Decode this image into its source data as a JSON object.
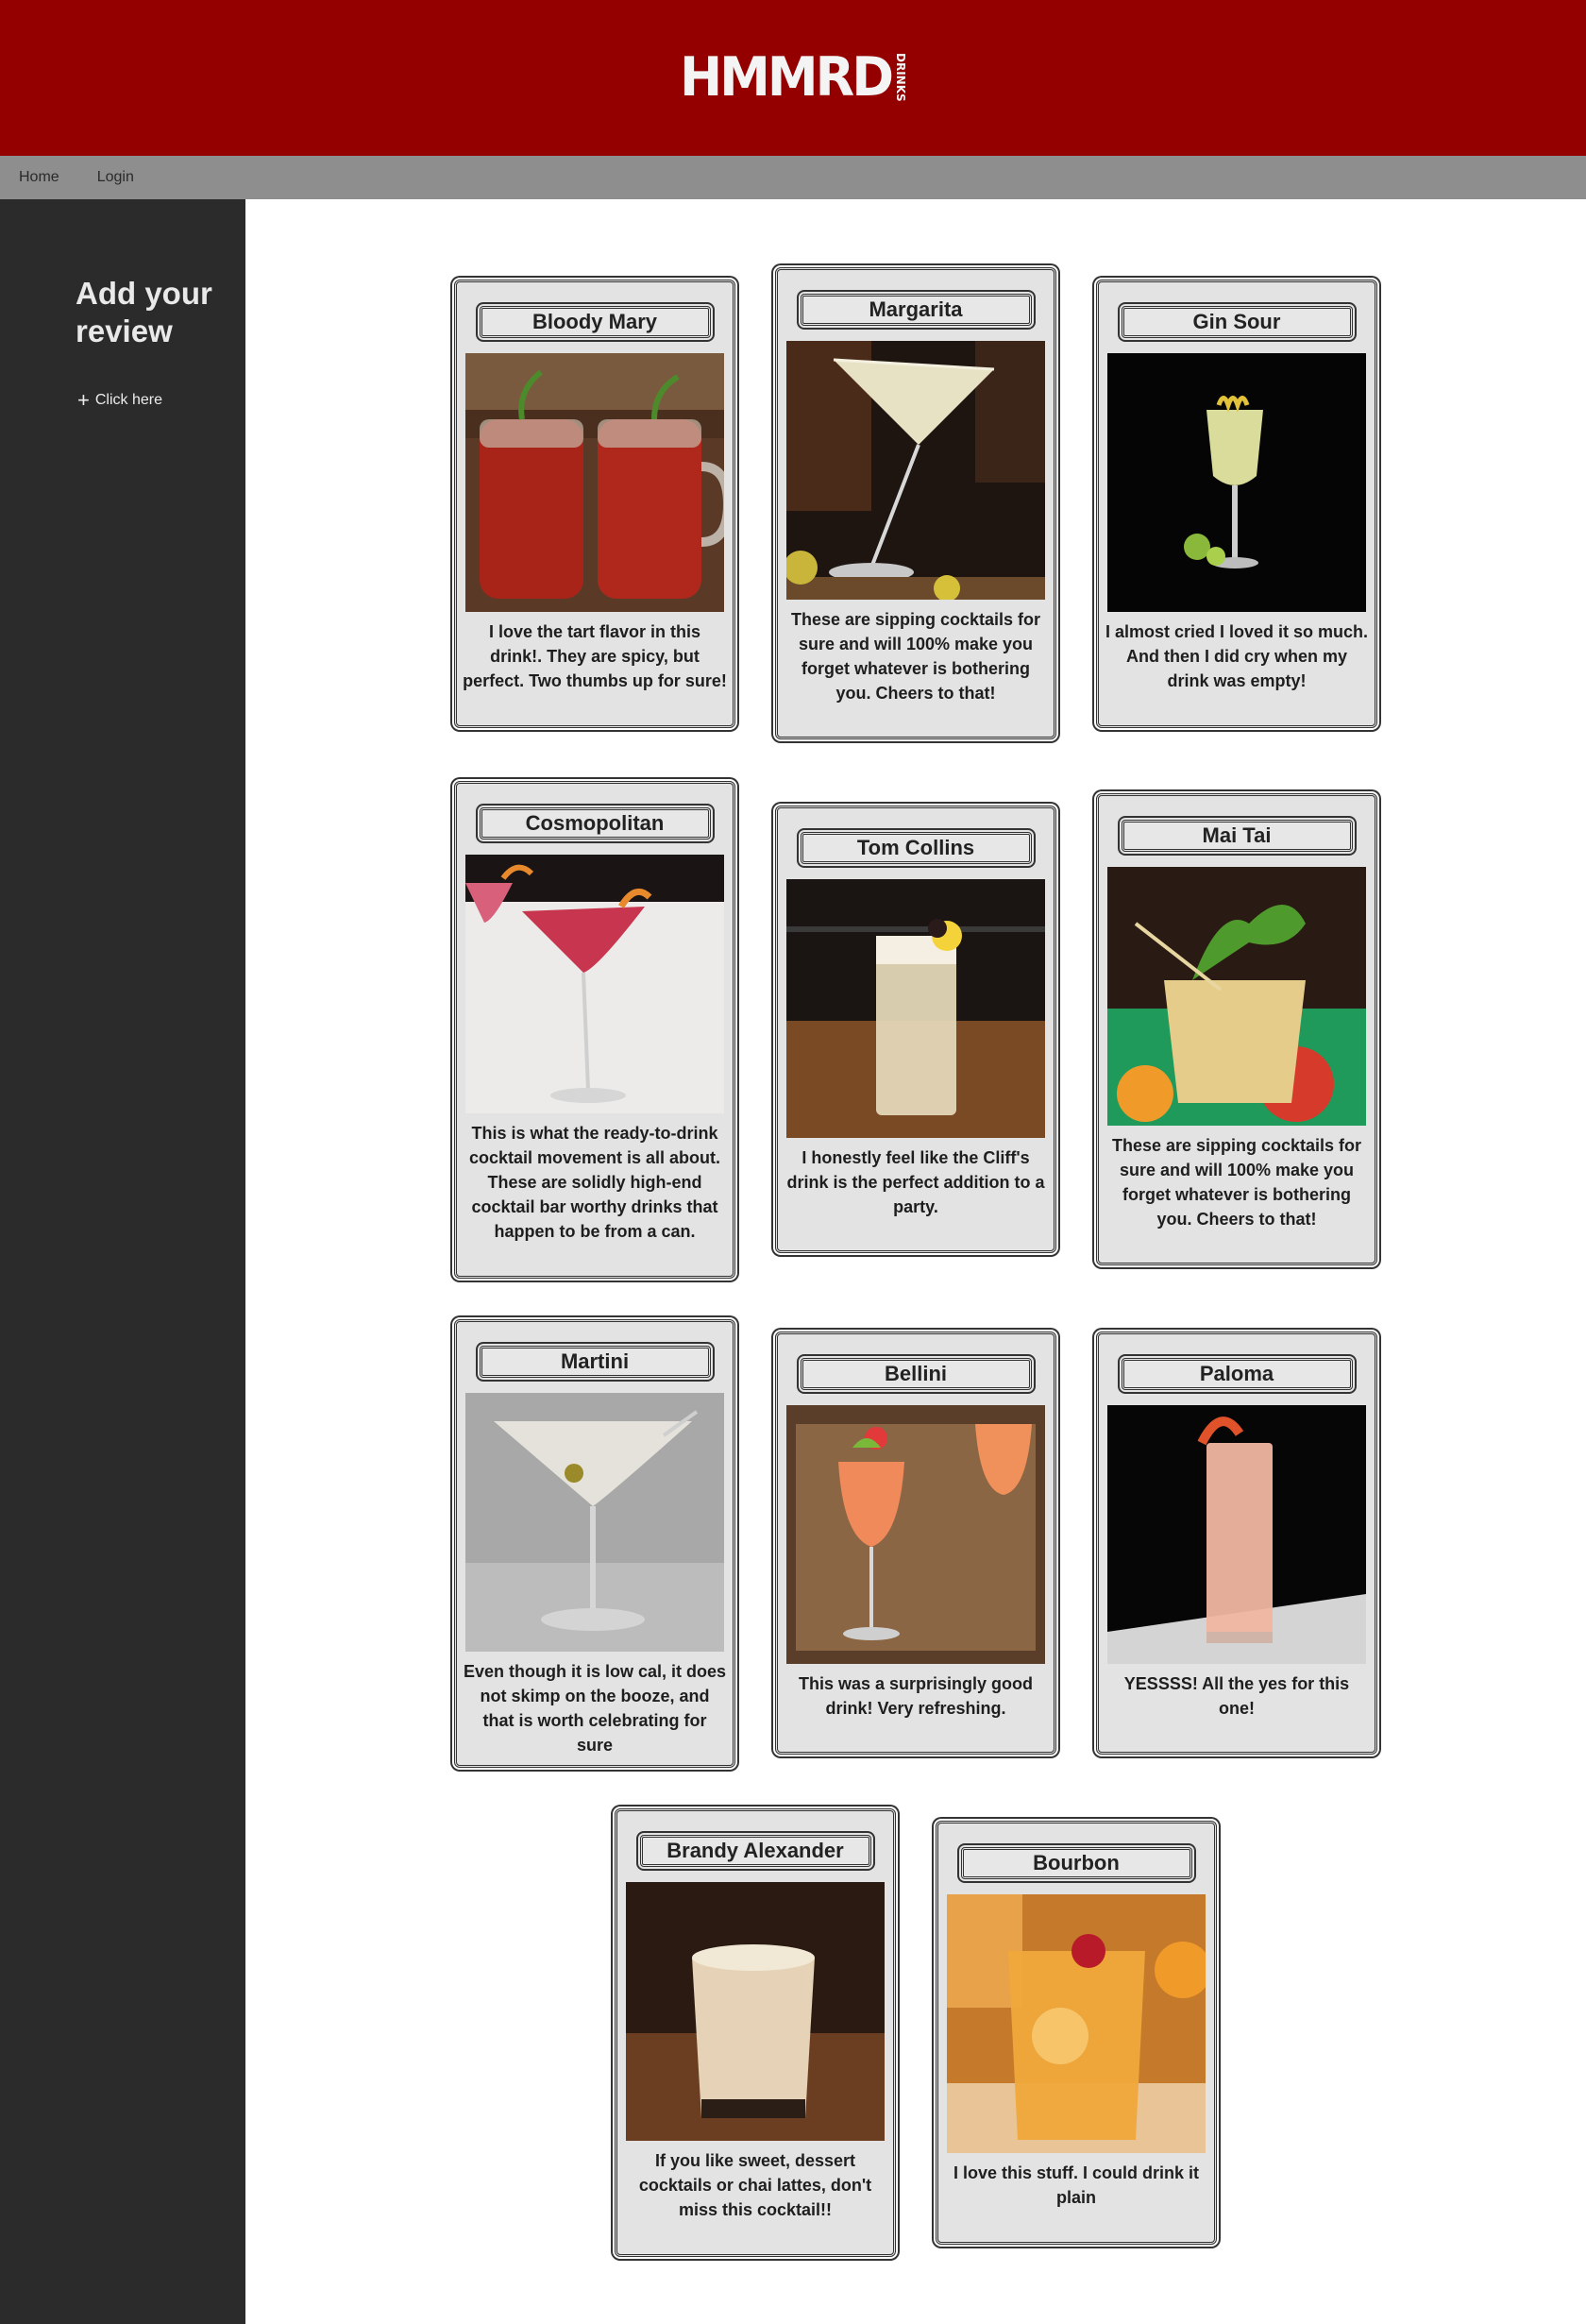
{
  "header": {
    "logo_text": "HMMRD",
    "logo_sub": "DRINKS"
  },
  "nav": {
    "items": [
      "Home",
      "Login"
    ]
  },
  "sidebar": {
    "title": "Add your review",
    "link_label": "Click here",
    "link_icon": "plus-icon"
  },
  "colors": {
    "header": "#940000",
    "nav": "#8e8e8e",
    "sidebar": "#2b2b2b",
    "card": "#e3e3e3"
  },
  "cards": [
    {
      "title": "Bloody Mary",
      "text": "I love the tart flavor in this drink!. They are spicy, but perfect. Two thumbs up for sure!"
    },
    {
      "title": "Margarita",
      "text": "These are sipping cocktails for sure and will 100% make you forget whatever is bothering you. Cheers to that!"
    },
    {
      "title": "Gin Sour",
      "text": "I almost cried I loved it so much. And then I did cry when my drink was empty!"
    },
    {
      "title": "Cosmopolitan",
      "text": "This is what the ready-to-drink cocktail movement is all about. These are solidly high-end cocktail bar worthy drinks that happen to be from a can."
    },
    {
      "title": "Tom Collins",
      "text": "I honestly feel like the Cliff's drink is the perfect addition to a party."
    },
    {
      "title": "Mai Tai",
      "text": "These are sipping cocktails for sure and will 100% make you forget whatever is bothering you. Cheers to that!"
    },
    {
      "title": "Martini",
      "text": "Even though it is low cal, it does not skimp on the booze, and that is worth celebrating for sure"
    },
    {
      "title": "Bellini",
      "text": "This was a surprisingly good drink! Very refreshing."
    },
    {
      "title": "Paloma",
      "text": "YESSSS! All the yes for this one!"
    },
    {
      "title": "Brandy Alexander",
      "text": "If you like sweet, dessert cocktails or chai lattes, don't miss this cocktail!!"
    },
    {
      "title": "Bourbon",
      "text": "I love this stuff. I could drink it plain"
    }
  ]
}
